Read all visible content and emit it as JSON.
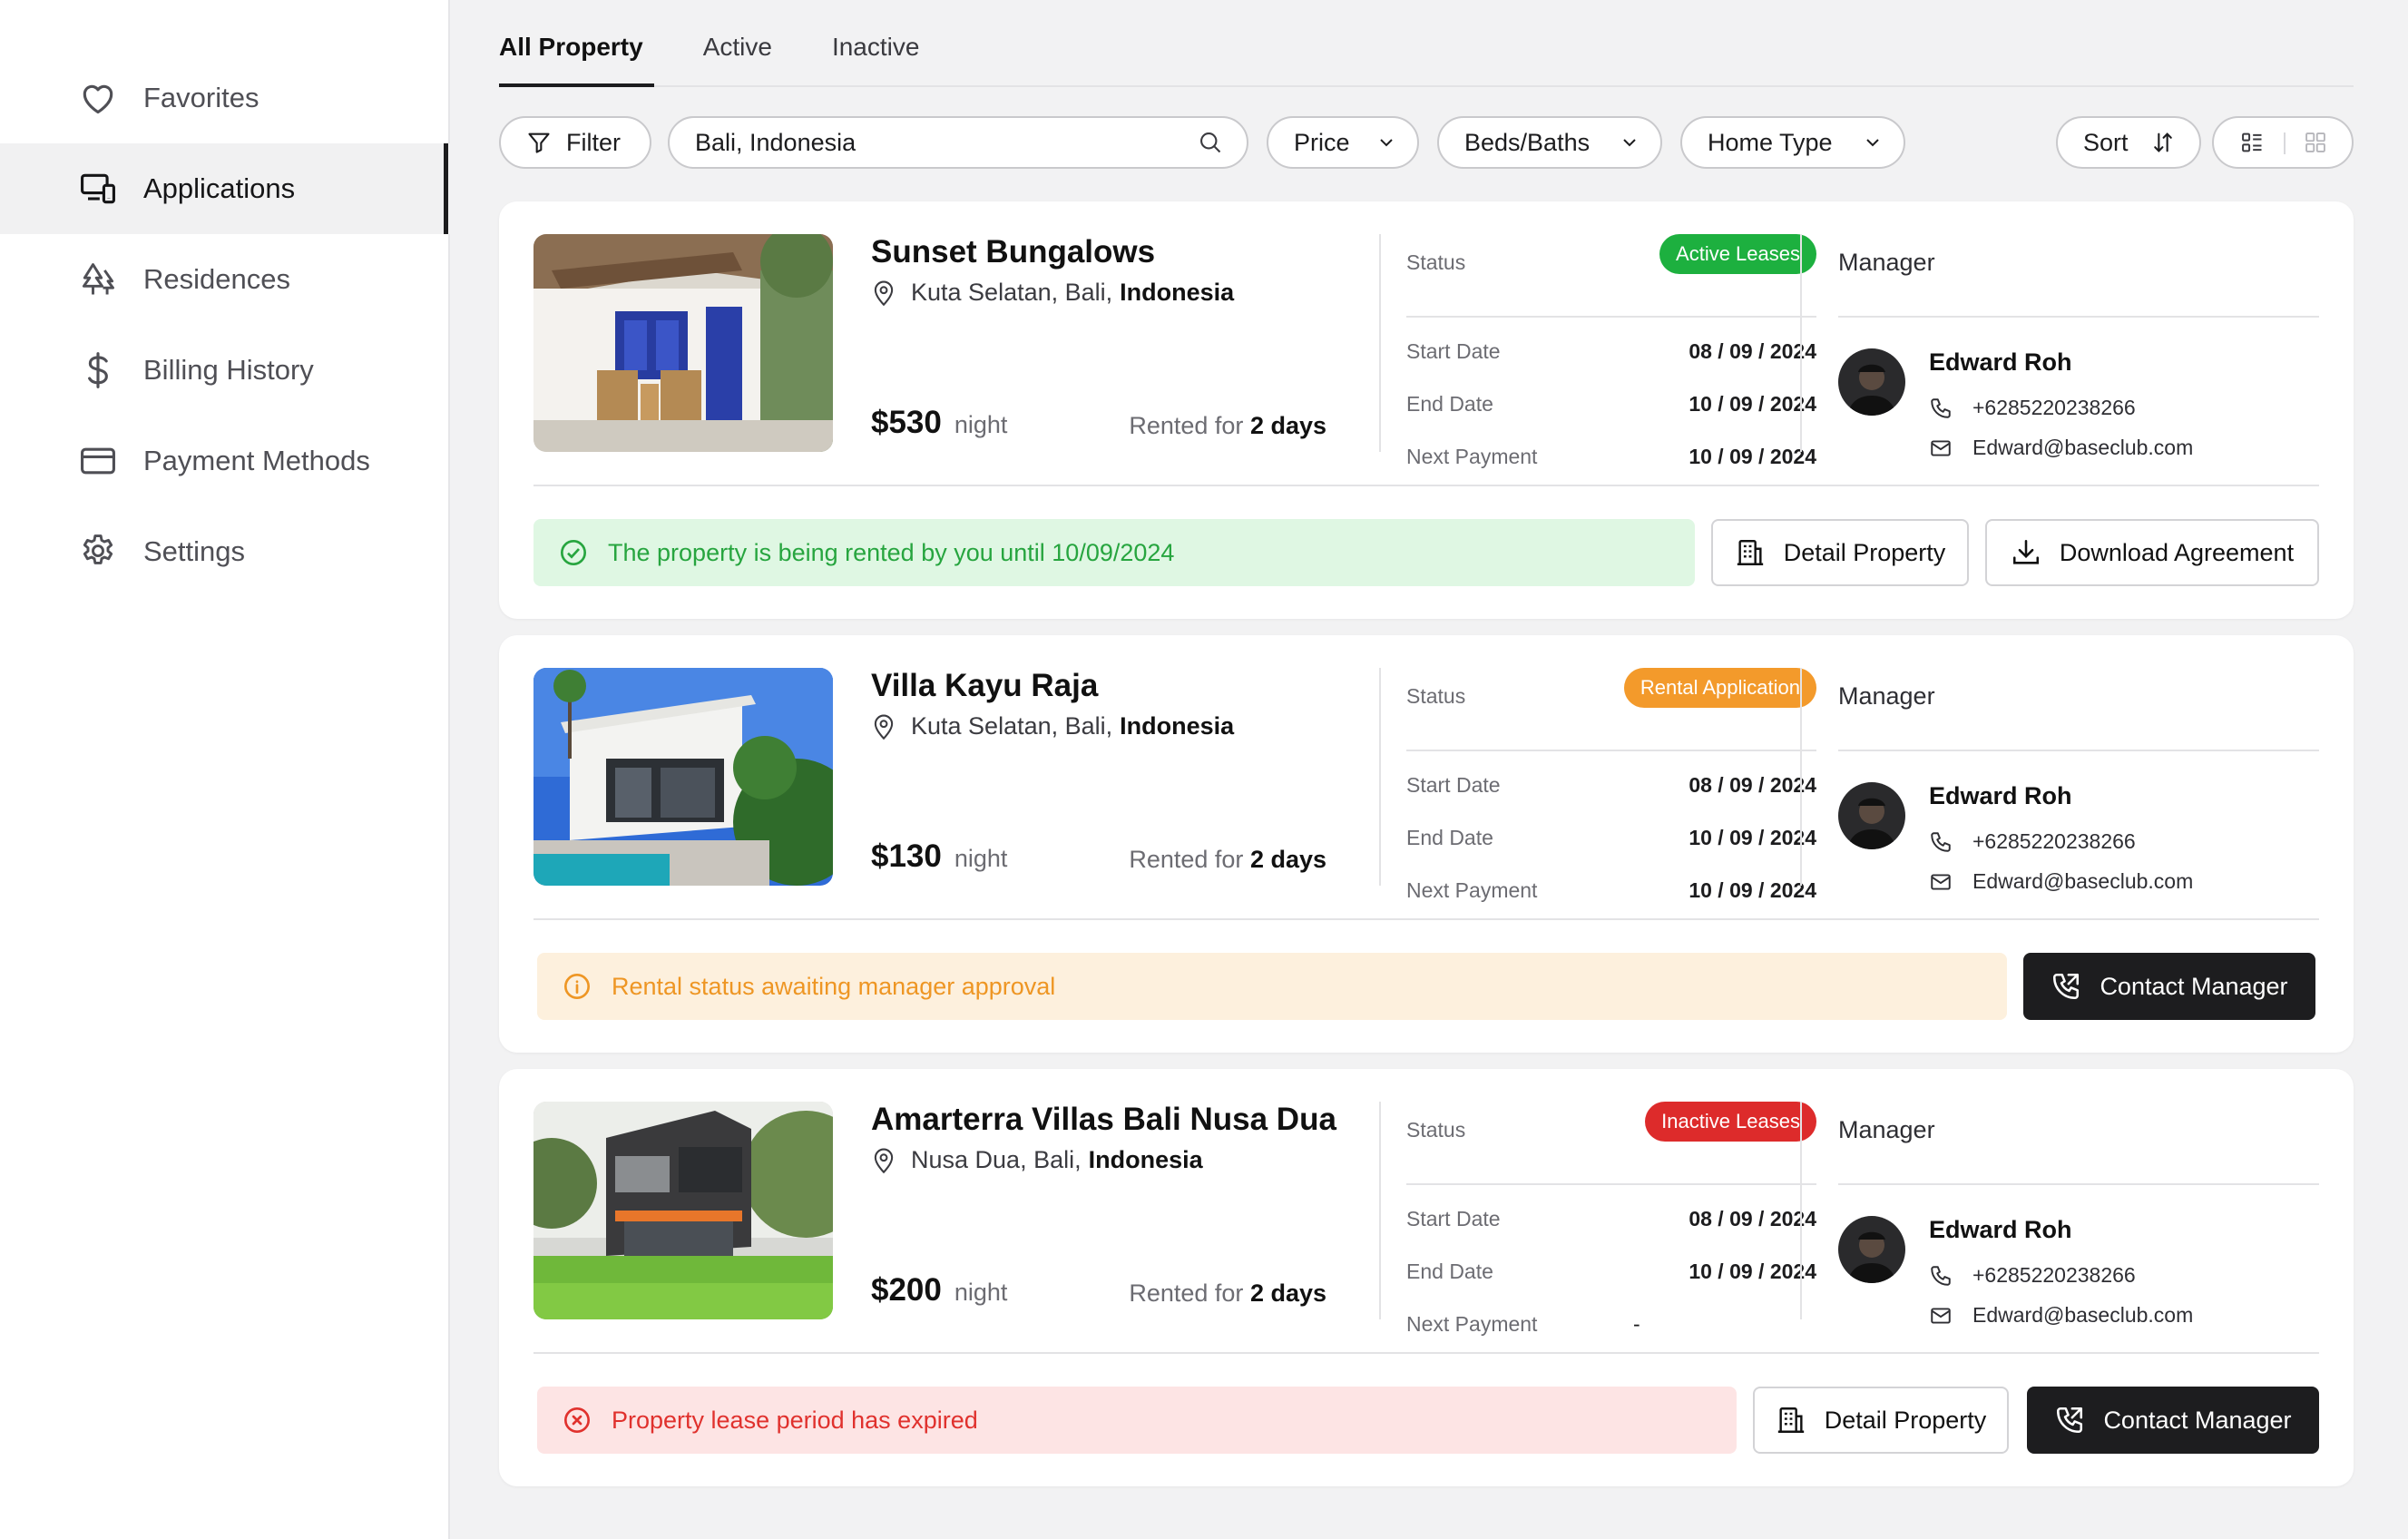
{
  "sidebar": {
    "items": [
      {
        "label": "Favorites",
        "icon": "heart-icon"
      },
      {
        "label": "Applications",
        "icon": "devices-icon",
        "active": true
      },
      {
        "label": "Residences",
        "icon": "trees-icon"
      },
      {
        "label": "Billing History",
        "icon": "dollar-icon"
      },
      {
        "label": "Payment Methods",
        "icon": "credit-card-icon"
      },
      {
        "label": "Settings",
        "icon": "gear-icon"
      }
    ]
  },
  "tabs": [
    {
      "label": "All Property",
      "active": true
    },
    {
      "label": "Active"
    },
    {
      "label": "Inactive"
    }
  ],
  "toolbar": {
    "filter_label": "Filter",
    "search_value": "Bali, Indonesia",
    "price_label": "Price",
    "beds_label": "Beds/Baths",
    "home_type_label": "Home Type",
    "sort_label": "Sort"
  },
  "labels": {
    "status": "Status",
    "start_date": "Start Date",
    "end_date": "End Date",
    "next_payment": "Next Payment",
    "manager": "Manager",
    "rented_for": "Rented for",
    "night": "night"
  },
  "colors": {
    "active_badge": "#1db03f",
    "pending_badge": "#f39a2b",
    "inactive_badge": "#dd2b2b",
    "success_bg": "#dff7e3",
    "success_text": "#27a53f",
    "warning_bg": "#fdf0dd",
    "warning_text": "#ee9624",
    "error_bg": "#fde4e4",
    "error_text": "#e0312d"
  },
  "properties": [
    {
      "name": "Sunset Bungalows",
      "location_prefix": "Kuta Selatan, Bali,",
      "location_country": "Indonesia",
      "price": "$530",
      "duration": "2 days",
      "status": "Active Leases",
      "start_date": "08 / 09 / 2024",
      "end_date": "10 / 09 / 2024",
      "next_payment": "10 / 09 / 2024",
      "manager_name": "Edward Roh",
      "manager_phone": "+6285220238266",
      "manager_email": "Edward@baseclub.com",
      "notice": "The property is being rented by you until 10/09/2024",
      "actions": [
        "Detail Property",
        "Download Agreement"
      ]
    },
    {
      "name": "Villa Kayu Raja",
      "location_prefix": "Kuta Selatan, Bali,",
      "location_country": "Indonesia",
      "price": "$130",
      "duration": "2 days",
      "status": "Rental Application",
      "start_date": "08 / 09 / 2024",
      "end_date": "10 / 09 / 2024",
      "next_payment": "10 / 09 / 2024",
      "manager_name": "Edward Roh",
      "manager_phone": "+6285220238266",
      "manager_email": "Edward@baseclub.com",
      "notice": "Rental status awaiting manager approval",
      "actions": [
        "Contact Manager"
      ]
    },
    {
      "name": "Amarterra Villas Bali Nusa Dua",
      "location_prefix": "Nusa Dua, Bali,",
      "location_country": "Indonesia",
      "price": "$200",
      "duration": "2 days",
      "status": "Inactive Leases",
      "start_date": "08 / 09 / 2024",
      "end_date": "10 / 09 / 2024",
      "next_payment": "-",
      "manager_name": "Edward Roh",
      "manager_phone": "+6285220238266",
      "manager_email": "Edward@baseclub.com",
      "notice": "Property lease period has expired",
      "actions": [
        "Detail Property",
        "Contact Manager"
      ]
    }
  ]
}
